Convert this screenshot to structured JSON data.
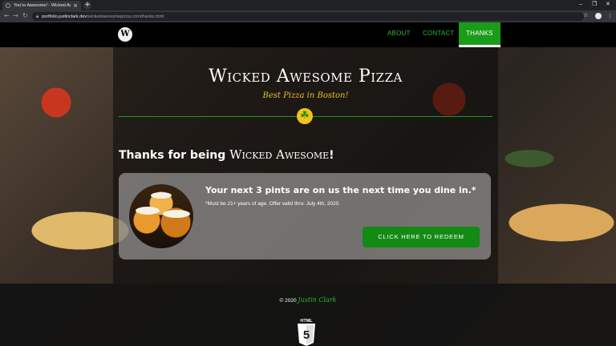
{
  "browser": {
    "tab_title": "You're Awesome! - Wicked Awe...",
    "url_host": "portfolio.justinclark.dev",
    "url_path": "/wickedawesomepizza.com/thanks.html"
  },
  "nav": {
    "logo_letter": "W",
    "links": [
      "ABOUT",
      "CONTACT",
      "THANKS"
    ],
    "active": "THANKS"
  },
  "hero": {
    "brand": "Wicked Awesome Pizza",
    "tagline": "Best Pizza in Boston!"
  },
  "thanks": {
    "prefix": "Thanks for being ",
    "brand": "Wicked Awesome",
    "suffix": "!"
  },
  "card": {
    "offer": "Your next 3 pints are on us the next time you dine in.*",
    "fine_print": "*Must be 21+ years of age. Offer valid thru: July 4th, 2020.",
    "button": "CLICK HERE TO REDEEM"
  },
  "footer": {
    "copyright": "© 2020",
    "author": "Justin Clark",
    "badge": "HTML"
  },
  "colors": {
    "accent_green": "#1a9b1a",
    "tagline_yellow": "#e5c229"
  }
}
